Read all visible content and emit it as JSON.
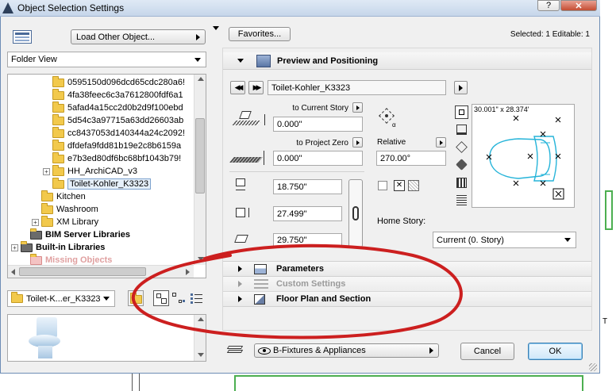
{
  "window": {
    "title": "Object Selection Settings",
    "help_label": "?",
    "close_label": "✕"
  },
  "left_panel": {
    "load_other_label": "Load Other Object...",
    "view_dropdown": "Folder View",
    "tree": [
      {
        "label": "0595150d096dcd65cdc280a6!",
        "depth": 3
      },
      {
        "label": "4fa38feec6c3a7612800fdf6a1",
        "depth": 3
      },
      {
        "label": "5afad4a15cc2d0b2d9f100ebd",
        "depth": 3
      },
      {
        "label": "5d54c3a97715a63dd26603ab",
        "depth": 3
      },
      {
        "label": "cc8437053d140344a24c2092!",
        "depth": 3
      },
      {
        "label": "dfdefa9fdd81b19e2c8b6159a",
        "depth": 3
      },
      {
        "label": "e7b3ed80df6bc68bf1043b79!",
        "depth": 3
      },
      {
        "label": "HH_ArchiCAD_v3",
        "depth": 3,
        "expander": "+"
      },
      {
        "label": "Toilet-Kohler_K3323",
        "depth": 3,
        "selected": true
      },
      {
        "label": "Kitchen",
        "depth": 2
      },
      {
        "label": "Washroom",
        "depth": 2
      },
      {
        "label": "XM Library",
        "depth": 2,
        "expander": "+"
      },
      {
        "label": "BIM Server Libraries",
        "depth": 1,
        "bold": true
      },
      {
        "label": "Built-in Libraries",
        "depth": 0,
        "bold": true,
        "expander": "+"
      },
      {
        "label": "Missing Objects",
        "depth": 1,
        "bold": true,
        "missing": true
      }
    ],
    "bottom_dropdown": "Toilet-K...er_K3323"
  },
  "right_panel": {
    "favorites_label": "Favorites...",
    "selected_info": "Selected: 1 Editable: 1",
    "preview_section": "Preview and Positioning",
    "object_name": "Toilet-Kohler_K3323",
    "to_current_story_label": "to Current Story",
    "to_current_story_value": "0.000\"",
    "to_project_zero_label": "to Project Zero",
    "to_project_zero_value": "0.000\"",
    "width_value": "18.750\"",
    "depth_value": "27.499\"",
    "height_value": "29.750\"",
    "relative_label": "Relative",
    "relative_value": "270.00°",
    "preview_dims": "30.001\" x 28.374'",
    "home_story_label": "Home Story:",
    "home_story_value": "Current (0. Story)",
    "parameters_label": "Parameters",
    "custom_settings_label": "Custom Settings",
    "floor_plan_label": "Floor Plan and Section",
    "layer_value": "B-Fixtures & Appliances",
    "cancel_label": "Cancel",
    "ok_label": "OK"
  },
  "colors": {
    "title_bar": "#c6d6ea",
    "annotation": "#cc1f1f",
    "preview_line": "#26b4d9"
  }
}
